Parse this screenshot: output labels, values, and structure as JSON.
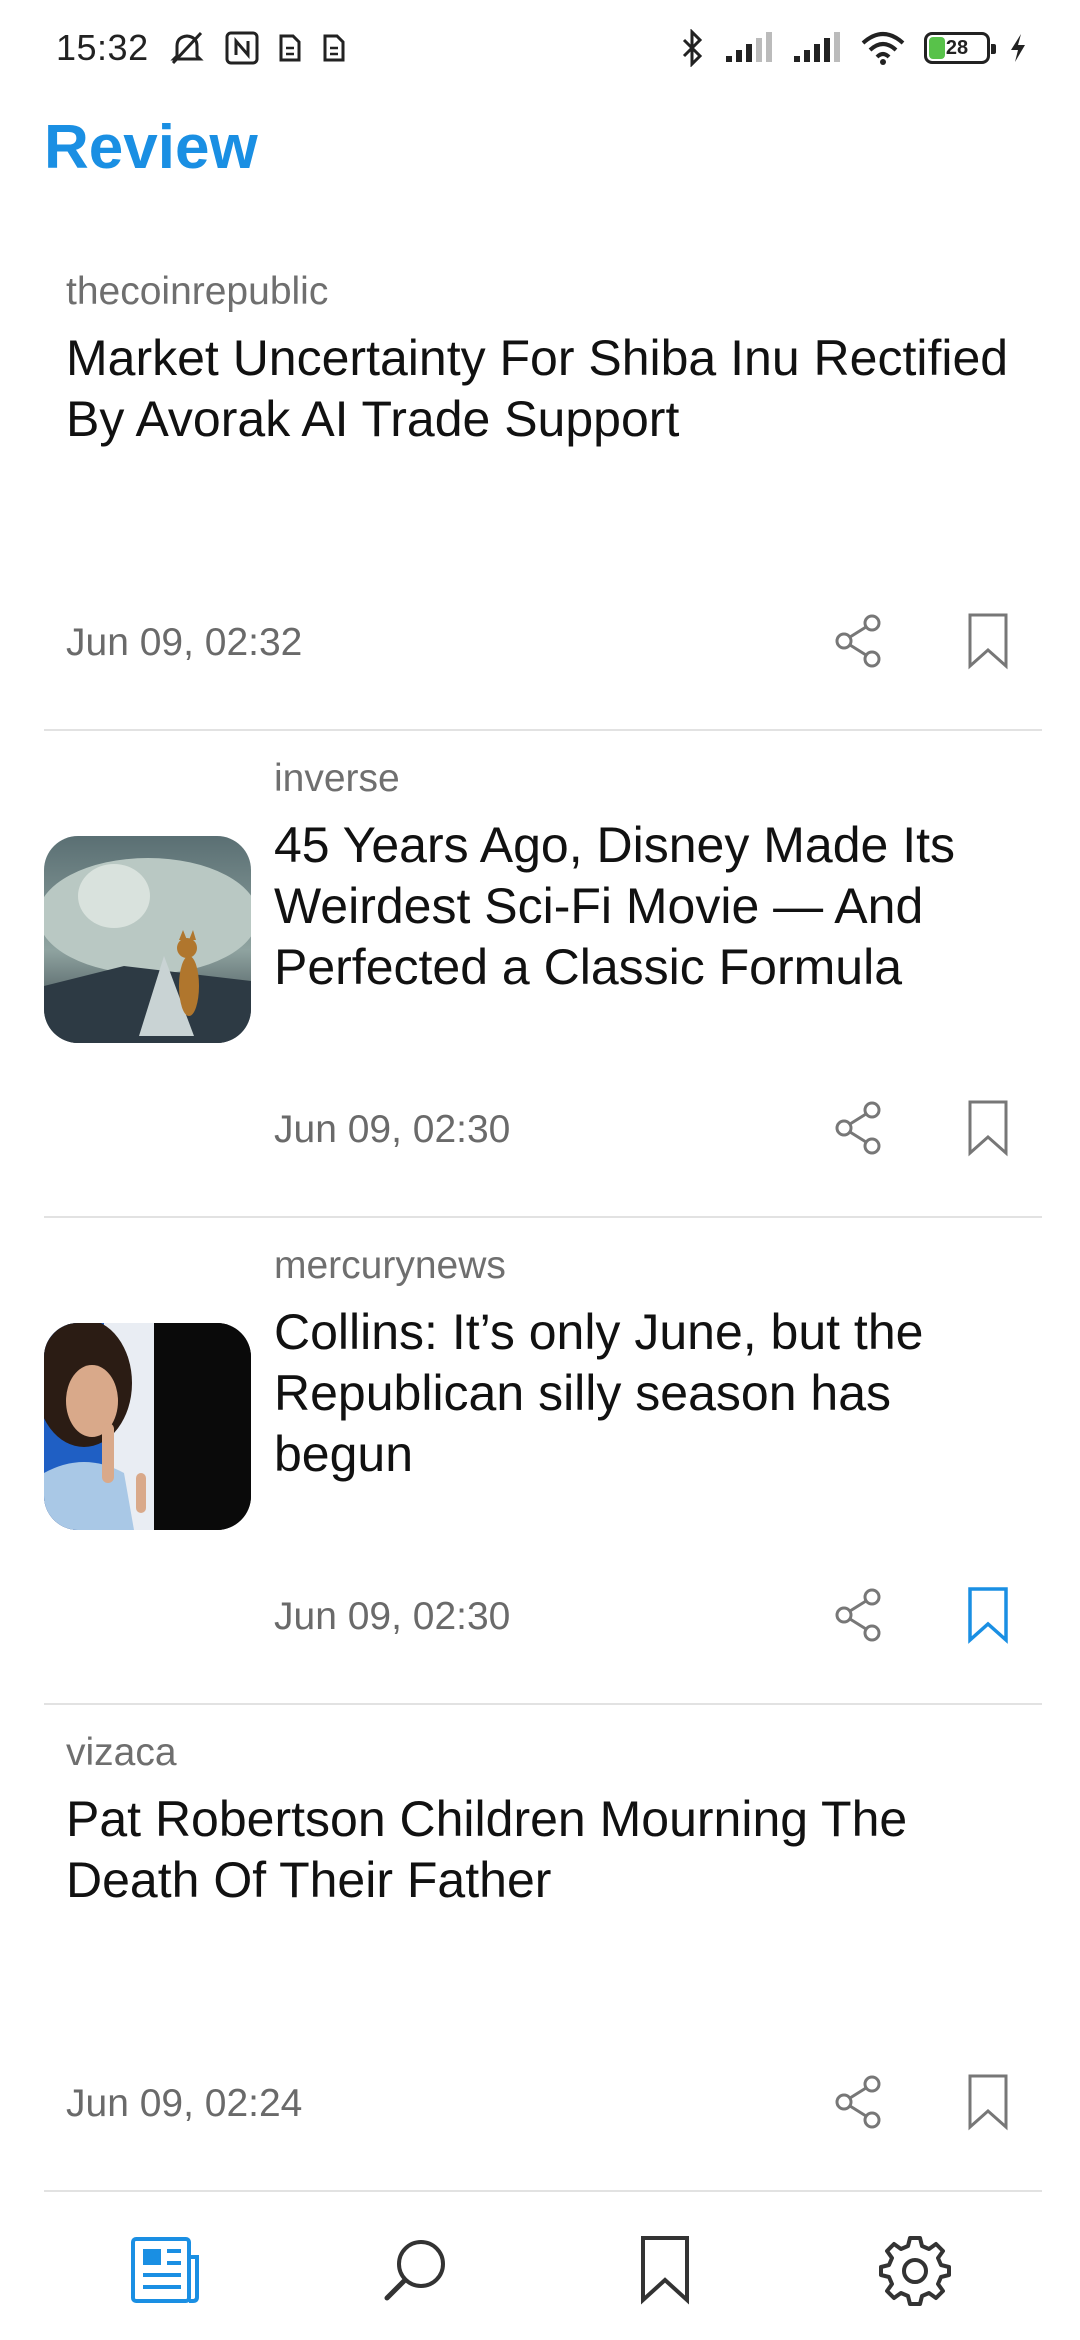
{
  "status_bar": {
    "time": "15:32",
    "battery_level": "28",
    "battery_fraction": 0.28,
    "icons": [
      "mute-icon",
      "nfc-icon",
      "sim-icon",
      "sim-icon",
      "bluetooth-icon",
      "signal-icon",
      "signal-icon",
      "wifi-icon",
      "battery-icon",
      "charging-icon"
    ]
  },
  "header": {
    "title": "Review"
  },
  "colors": {
    "accent": "#1a8fe3",
    "text": "#111111",
    "muted": "#6f6f6f",
    "divider": "#e2e2e2",
    "battery": "#58c24a"
  },
  "articles": [
    {
      "source": "thecoinrepublic",
      "headline": "Market Uncertainty For Shiba Inu Rectified By Avorak AI Trade Support",
      "date": "Jun 09, 02:32",
      "thumbnail": null,
      "bookmarked": false
    },
    {
      "source": "inverse",
      "headline": "45 Years Ago, Disney Made Its Weirdest Sci-Fi Movie — And Perfected a Classic Formula",
      "date": "Jun 09, 02:30",
      "thumbnail": "spaceship-cat-image",
      "bookmarked": false
    },
    {
      "source": "mercurynews",
      "headline": "Collins: It’s only June, but the Republican silly season has begun",
      "date": "Jun 09, 02:30",
      "thumbnail": "speaker-portrait-image",
      "bookmarked": true
    },
    {
      "source": "vizaca",
      "headline": "Pat Robertson Children Mourning The Death Of Their Father",
      "date": "Jun 09, 02:24",
      "thumbnail": null,
      "bookmarked": false
    }
  ],
  "bottom_nav": [
    {
      "icon": "news-icon",
      "active": true
    },
    {
      "icon": "search-icon",
      "active": false
    },
    {
      "icon": "bookmark-icon",
      "active": false
    },
    {
      "icon": "settings-icon",
      "active": false
    }
  ]
}
